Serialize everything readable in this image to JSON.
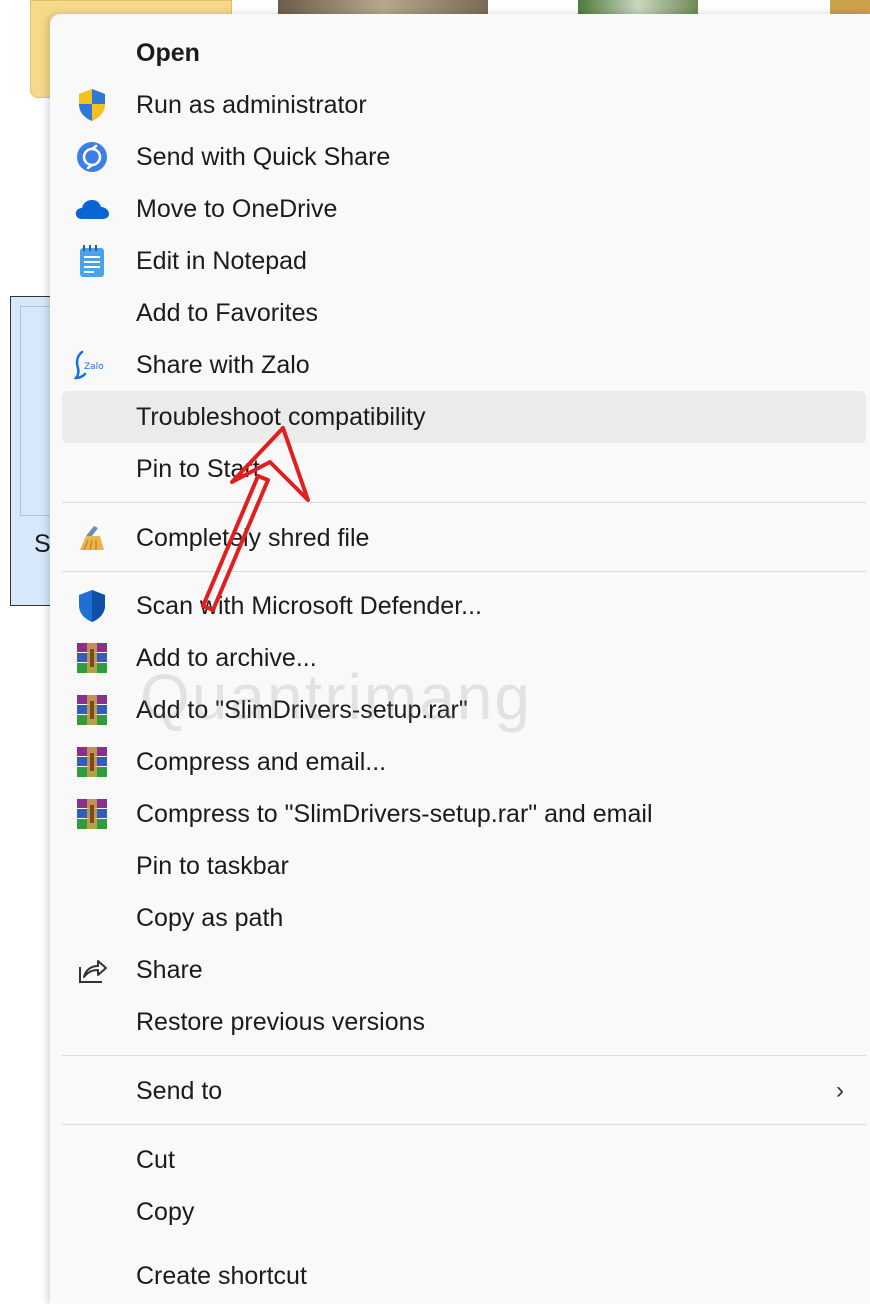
{
  "menu": {
    "items": [
      {
        "label": "Open",
        "icon": "none"
      },
      {
        "label": "Run as administrator",
        "icon": "shield-icon"
      },
      {
        "label": "Send with Quick Share",
        "icon": "quick-share-icon"
      },
      {
        "label": "Move to OneDrive",
        "icon": "onedrive-icon"
      },
      {
        "label": "Edit in Notepad",
        "icon": "notepad-icon"
      },
      {
        "label": "Add to Favorites",
        "icon": "none"
      },
      {
        "label": "Share with Zalo",
        "icon": "zalo-icon"
      },
      {
        "label": "Troubleshoot compatibility",
        "icon": "none"
      },
      {
        "label": "Pin to Start",
        "icon": "none"
      },
      {
        "label": "Completely shred file",
        "icon": "shred-icon"
      },
      {
        "label": "Scan with Microsoft Defender...",
        "icon": "defender-icon"
      },
      {
        "label": "Add to archive...",
        "icon": "winrar-icon"
      },
      {
        "label": "Add to \"SlimDrivers-setup.rar\"",
        "icon": "winrar-icon"
      },
      {
        "label": "Compress and email...",
        "icon": "winrar-icon"
      },
      {
        "label": "Compress to \"SlimDrivers-setup.rar\" and email",
        "icon": "winrar-icon"
      },
      {
        "label": "Pin to taskbar",
        "icon": "none"
      },
      {
        "label": "Copy as path",
        "icon": "none"
      },
      {
        "label": "Share",
        "icon": "share-icon"
      },
      {
        "label": "Restore previous versions",
        "icon": "none"
      },
      {
        "label": "Send to",
        "icon": "none"
      },
      {
        "label": "Cut",
        "icon": "none"
      },
      {
        "label": "Copy",
        "icon": "none"
      },
      {
        "label": "Create shortcut",
        "icon": "none"
      }
    ]
  },
  "background": {
    "selected_file_fragment": "Sl"
  },
  "watermark": "Quantrimang",
  "colors": {
    "hover": "#ebebeb",
    "annotation_arrow": "#e0201e",
    "menu_bg": "#f9f9f9"
  }
}
